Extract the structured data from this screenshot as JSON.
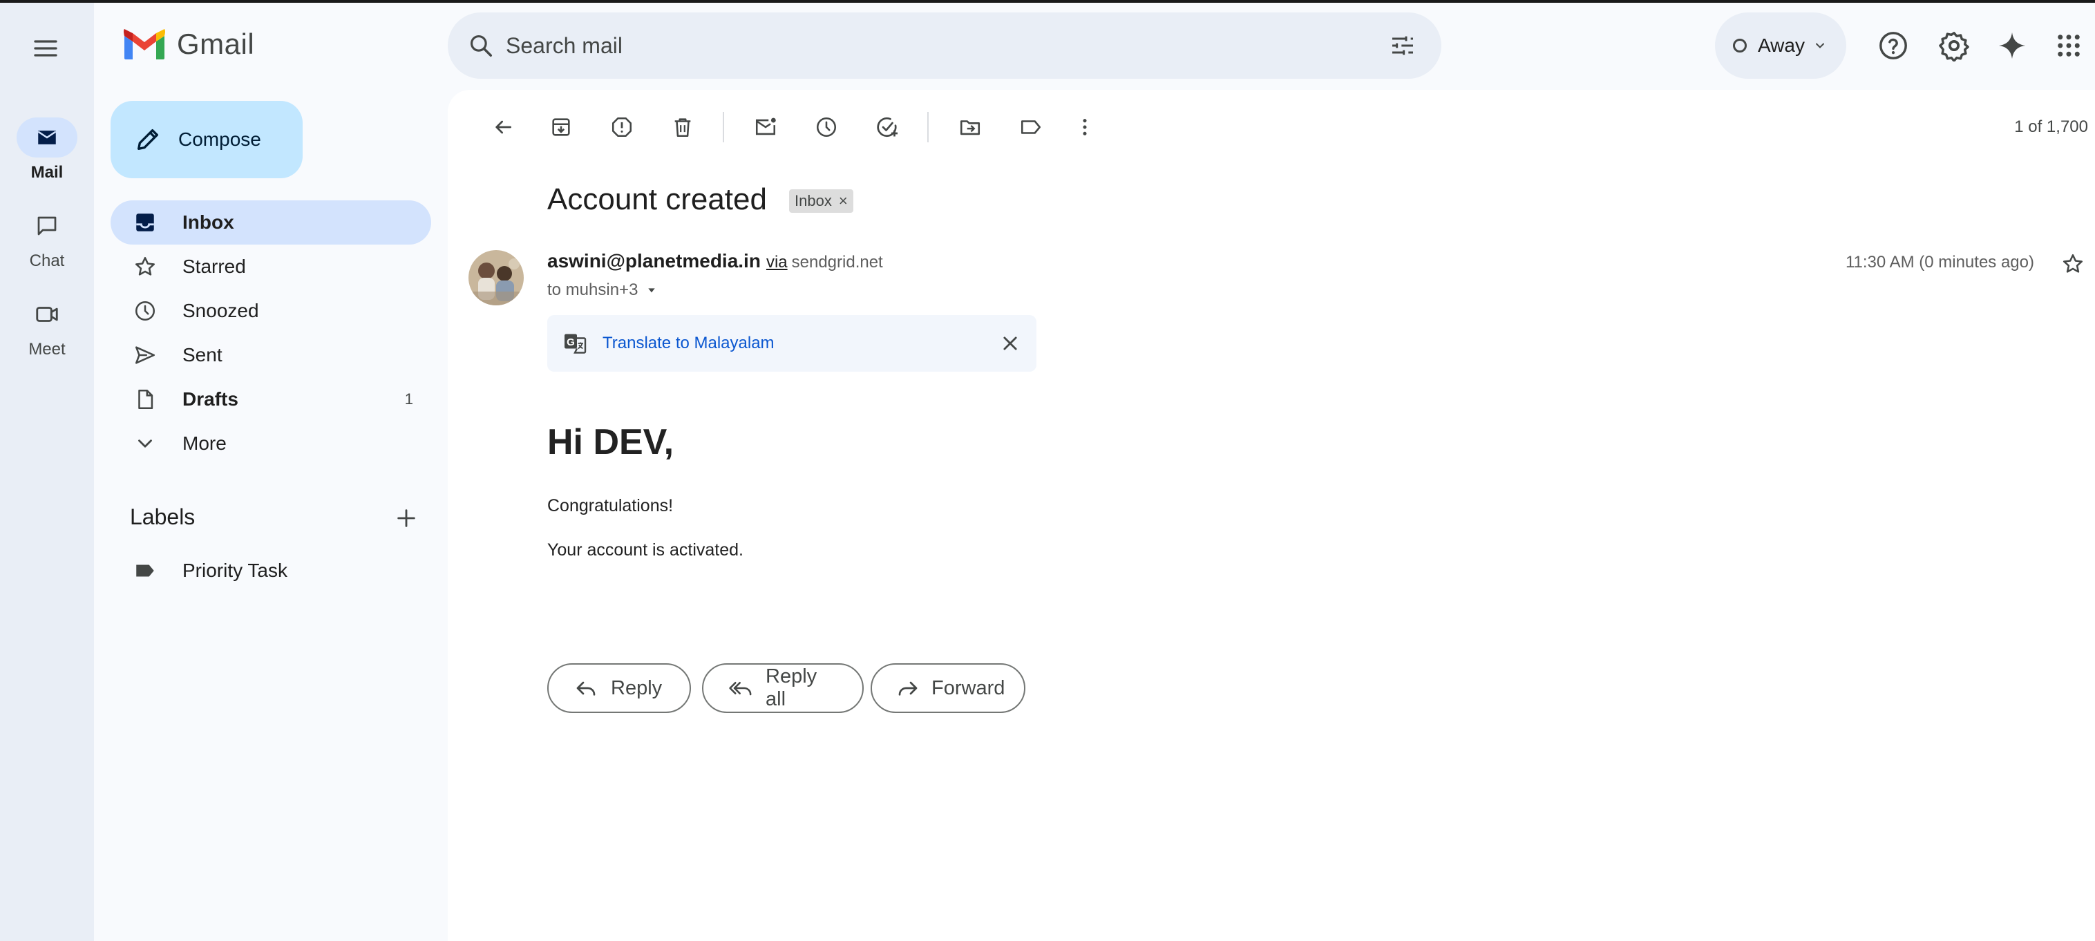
{
  "app": {
    "name": "Gmail"
  },
  "rail": {
    "items": [
      {
        "label": "Mail",
        "icon": "mail-icon",
        "active": true
      },
      {
        "label": "Chat",
        "icon": "chat-icon",
        "active": false
      },
      {
        "label": "Meet",
        "icon": "meet-icon",
        "active": false
      }
    ]
  },
  "nav": {
    "compose_label": "Compose",
    "items": [
      {
        "label": "Inbox",
        "icon": "inbox-icon",
        "count": ""
      },
      {
        "label": "Starred",
        "icon": "star-icon",
        "count": ""
      },
      {
        "label": "Snoozed",
        "icon": "clock-icon",
        "count": ""
      },
      {
        "label": "Sent",
        "icon": "send-icon",
        "count": ""
      },
      {
        "label": "Drafts",
        "icon": "draft-icon",
        "count": "1"
      },
      {
        "label": "More",
        "icon": "chevron-down-icon",
        "count": ""
      }
    ],
    "labels_heading": "Labels",
    "labels": [
      {
        "label": "Priority Task",
        "icon": "label-icon"
      }
    ]
  },
  "search": {
    "placeholder": "Search mail"
  },
  "status": {
    "label": "Away"
  },
  "toolbar": {
    "pager": "1 of 1,700"
  },
  "email": {
    "subject": "Account created",
    "label_chip": "Inbox",
    "sender_email": "aswini@planetmedia.in",
    "via": "via",
    "via_domain": "sendgrid.net",
    "to": "to muhsin+3",
    "time": "11:30 AM (0 minutes ago)",
    "translate_link": "Translate to Malayalam",
    "greeting": "Hi DEV,",
    "body": [
      "Congratulations!",
      "Your account is activated."
    ]
  },
  "actions": {
    "reply": "Reply",
    "reply_all": "Reply all",
    "forward": "Forward"
  },
  "colors": {
    "accent": "#0b57d0",
    "nav_active": "#d3e3fd",
    "compose_bg": "#c2e7ff",
    "rail_bg": "#e9eef6"
  }
}
